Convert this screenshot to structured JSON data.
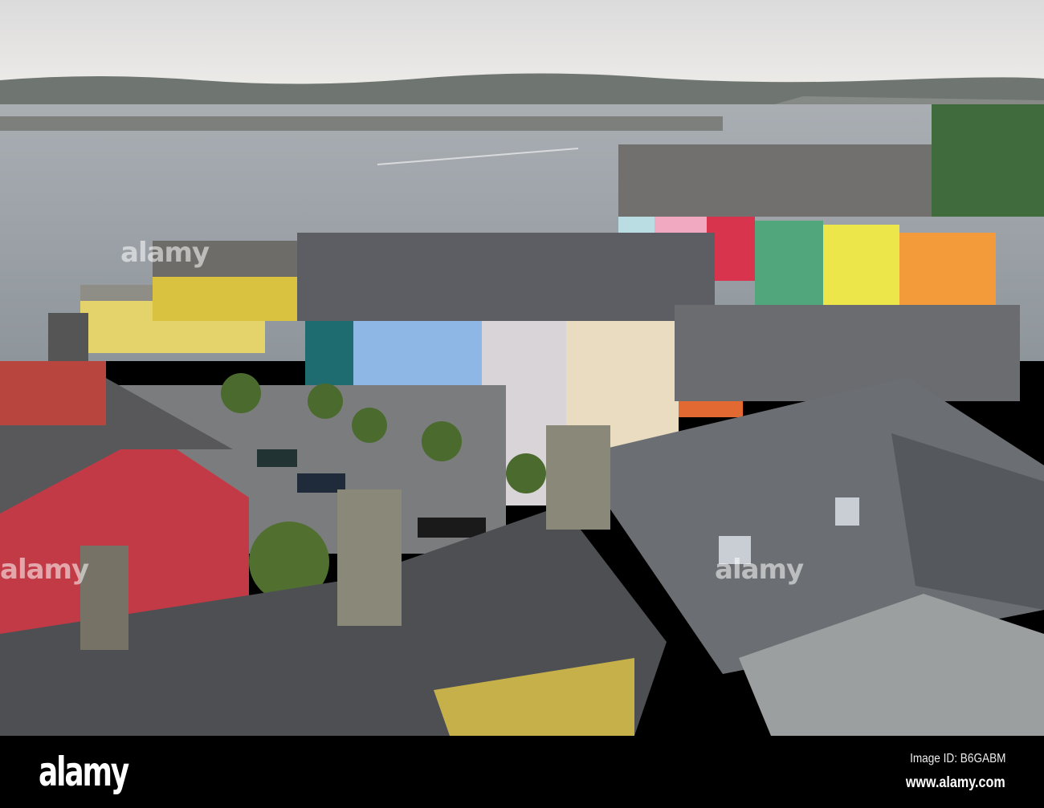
{
  "watermark": {
    "text": "alamy"
  },
  "footer": {
    "logo": "alamy",
    "image_id": "Image ID: B6GABM",
    "website": "www.alamy.com"
  },
  "colors": {
    "sky": "#e4e2e2",
    "water": "#9aa0a6",
    "roof": "#5f6266",
    "red_building": "#c23a45",
    "footer": "#000000"
  }
}
